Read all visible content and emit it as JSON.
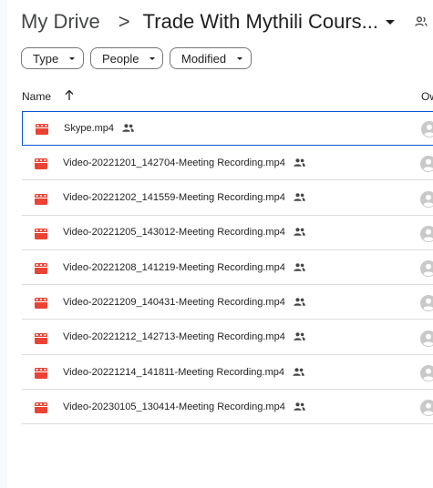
{
  "breadcrumb": {
    "root": "My Drive",
    "separator": ">",
    "current": "Trade With Mythili Cours..."
  },
  "filters": {
    "type": "Type",
    "people": "People",
    "modified": "Modified"
  },
  "columns": {
    "name": "Name",
    "owner": "Ow"
  },
  "colors": {
    "video_icon": "#ea4335",
    "selection": "#0b57d0",
    "divider": "#dadce0"
  },
  "files": [
    {
      "name": "Skype.mp4",
      "icon": "video-file-icon",
      "shared": true
    },
    {
      "name": "Video-20221201_142704-Meeting Recording.mp4",
      "icon": "video-file-icon",
      "shared": true
    },
    {
      "name": "Video-20221202_141559-Meeting Recording.mp4",
      "icon": "video-file-icon",
      "shared": true
    },
    {
      "name": "Video-20221205_143012-Meeting Recording.mp4",
      "icon": "video-file-icon",
      "shared": true
    },
    {
      "name": "Video-20221208_141219-Meeting Recording.mp4",
      "icon": "video-file-icon",
      "shared": true
    },
    {
      "name": "Video-20221209_140431-Meeting Recording.mp4",
      "icon": "video-file-icon",
      "shared": true
    },
    {
      "name": "Video-20221212_142713-Meeting Recording.mp4",
      "icon": "video-file-icon",
      "shared": true
    },
    {
      "name": "Video-20221214_141811-Meeting Recording.mp4",
      "icon": "video-file-icon",
      "shared": true
    },
    {
      "name": "Video-20230105_130414-Meeting Recording.mp4",
      "icon": "video-file-icon",
      "shared": true
    }
  ]
}
